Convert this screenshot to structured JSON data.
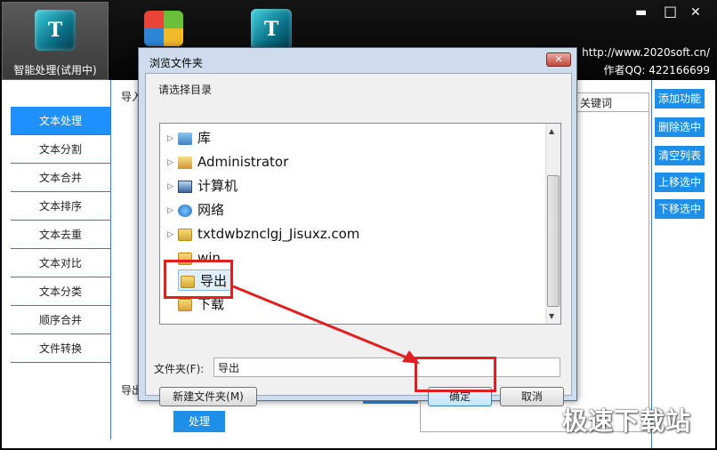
{
  "app": {
    "tabs": [
      {
        "label": "智能处理(试用中)",
        "icon_letter": "T"
      },
      {
        "label": "",
        "icon_letter": ""
      },
      {
        "label": "",
        "icon_letter": "T"
      }
    ],
    "window_controls": {
      "minimize": "▬",
      "maximize": "□",
      "close": "✕"
    },
    "website": "http://www.2020soft.cn/",
    "author_qq": "作者QQ: 422166699"
  },
  "sidebar": {
    "items": [
      {
        "label": "文本处理",
        "active": true
      },
      {
        "label": "文本分割"
      },
      {
        "label": "文本合并"
      },
      {
        "label": "文本排序"
      },
      {
        "label": "文本去重"
      },
      {
        "label": "文本对比"
      },
      {
        "label": "文本分类"
      },
      {
        "label": "顺序合并"
      },
      {
        "label": "文件转换"
      }
    ]
  },
  "main": {
    "import_label": "导入",
    "export_label": "导出",
    "keyword_header": "关键词",
    "process_button": "处理"
  },
  "right_buttons": [
    "添加功能",
    "删除选中",
    "清空列表",
    "上移选中",
    "下移选中"
  ],
  "dialog": {
    "title": "浏览文件夹",
    "close_glyph": "✕",
    "prompt": "请选择目录",
    "tree": [
      {
        "label": "库",
        "icon": "library-icon",
        "expandable": true
      },
      {
        "label": "Administrator",
        "icon": "user-folder-icon",
        "expandable": true
      },
      {
        "label": "计算机",
        "icon": "computer-icon",
        "expandable": true
      },
      {
        "label": "网络",
        "icon": "network-icon",
        "expandable": true
      },
      {
        "label": "txtdwbznclgj_Jisuxz.com",
        "icon": "folder-icon",
        "expandable": true
      },
      {
        "label": "win",
        "icon": "folder-icon",
        "expandable": false
      },
      {
        "label": "导出",
        "icon": "folder-icon",
        "expandable": false,
        "selected": true
      },
      {
        "label": "下载",
        "icon": "folder-icon",
        "expandable": false
      }
    ],
    "folder_label": "文件夹(F):",
    "folder_value": "导出",
    "new_folder_button": "新建文件夹(M)",
    "ok_button": "确定",
    "cancel_button": "取消"
  },
  "watermark": "极速下载站",
  "colors": {
    "accent": "#1e8fe8",
    "annotation": "#e02020",
    "titlebar": "#0b0b0b"
  }
}
